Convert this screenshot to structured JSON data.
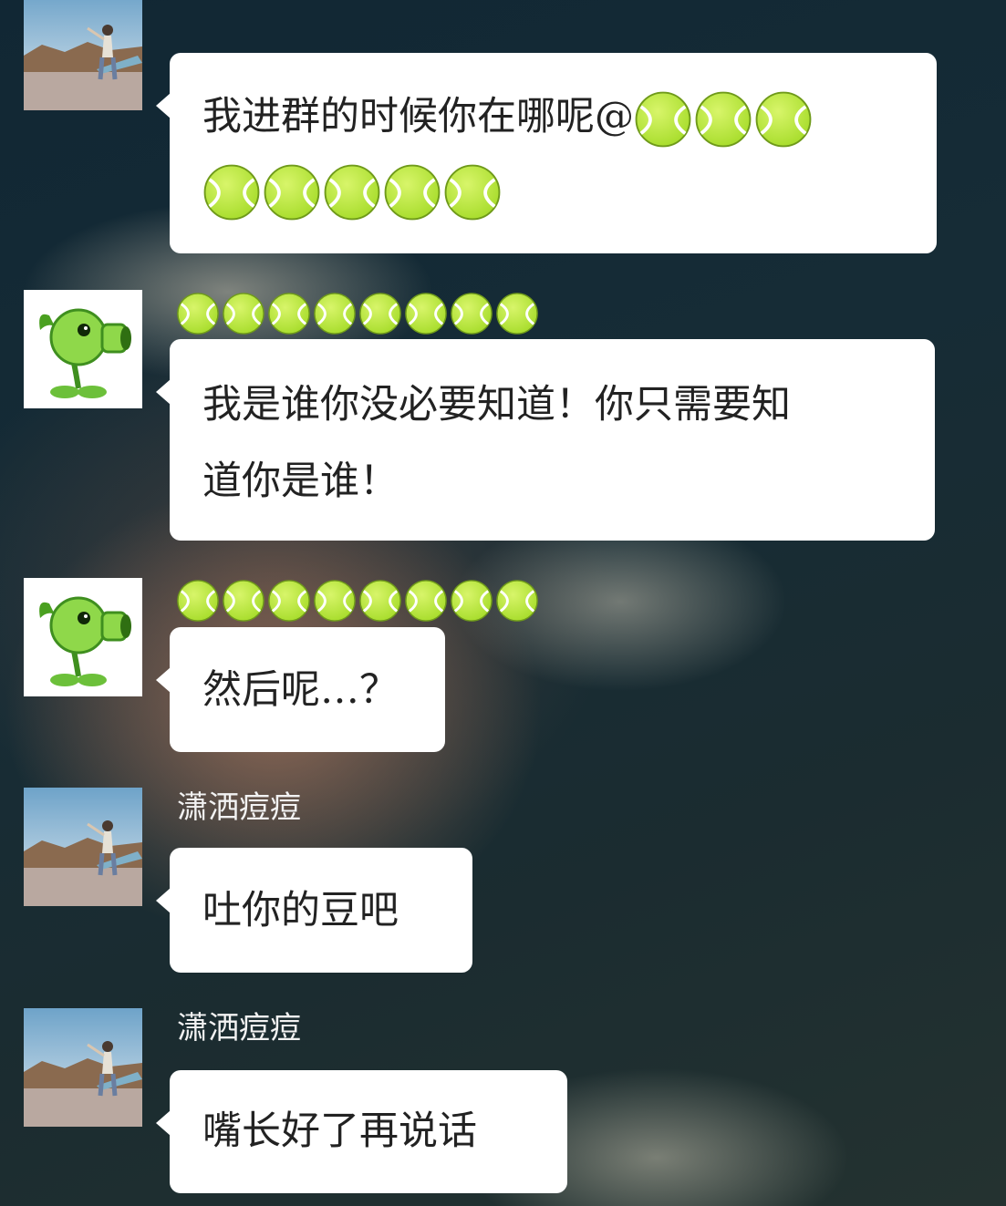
{
  "messages": [
    {
      "id": "m1",
      "avatar": "road-photo-avatar",
      "sender": "",
      "text_line1": "我进群的时候你在哪呢@",
      "emoji": "tennis-ball-icon",
      "emoji_count_line1": 3,
      "emoji_count_line2": 5
    },
    {
      "id": "m2",
      "avatar": "peashooter-avatar",
      "sender_emoji": "tennis-ball-icon",
      "sender_emoji_count": 8,
      "text_line1": "我是谁你没必要知道！你只需要知",
      "text_line2": "道你是谁！"
    },
    {
      "id": "m3",
      "avatar": "peashooter-avatar",
      "sender_emoji": "tennis-ball-icon",
      "sender_emoji_count": 8,
      "text": "然后呢…？"
    },
    {
      "id": "m4",
      "avatar": "road-photo-avatar",
      "sender": "潇洒痘痘",
      "text": "吐你的豆吧"
    },
    {
      "id": "m5",
      "avatar": "road-photo-avatar",
      "sender": "潇洒痘痘",
      "text": "嘴长好了再说话"
    }
  ],
  "colors": {
    "bubble": "#ffffff",
    "text": "#222222",
    "sender_name": "#f2f2f2",
    "tennis_ball": "#a6dc2a",
    "background": "#162c36"
  }
}
